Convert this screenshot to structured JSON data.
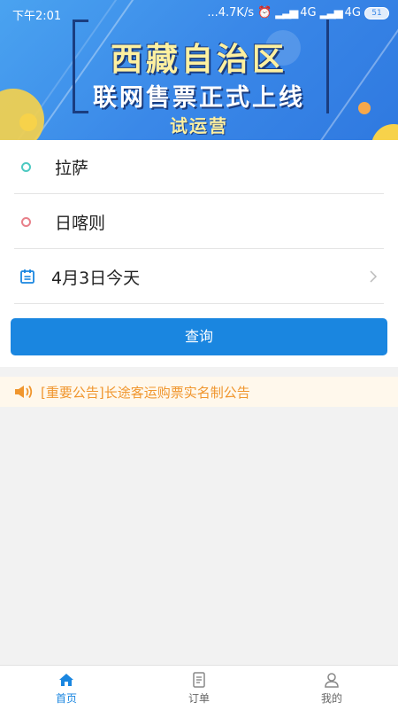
{
  "status_bar": {
    "time": "下午2:01",
    "network_speed": "...4.7K/s",
    "signal1": "4G",
    "signal2": "4G",
    "battery": "51"
  },
  "banner": {
    "line1": "西藏自治区",
    "line2": "联网售票正式上线",
    "line3": "试运营"
  },
  "search": {
    "from": "拉萨",
    "to": "日喀则",
    "date": "4月3日今天",
    "button": "查询"
  },
  "notice": {
    "text": "[重要公告]长途客运购票实名制公告"
  },
  "tabbar": {
    "tabs": [
      {
        "label": "首页",
        "icon": "home-icon",
        "active": true
      },
      {
        "label": "订单",
        "icon": "order-icon",
        "active": false
      },
      {
        "label": "我的",
        "icon": "profile-icon",
        "active": false
      }
    ]
  },
  "colors": {
    "accent": "#1a86e0",
    "notice_text": "#f0962e",
    "from_dot": "#4dc9c1",
    "to_dot": "#e8808a"
  }
}
